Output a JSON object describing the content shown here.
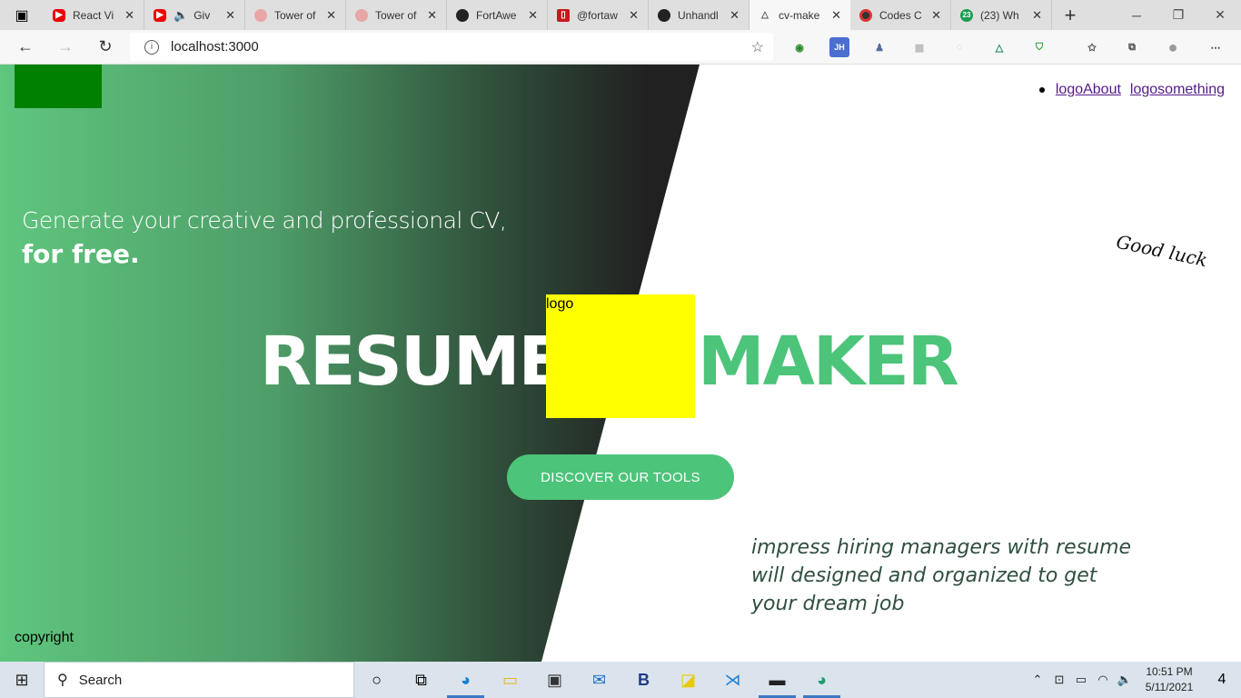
{
  "browser": {
    "tabs": [
      {
        "title": "React Vi",
        "icon": "youtube-icon"
      },
      {
        "title": "Giv",
        "icon": "youtube-icon",
        "audio": true
      },
      {
        "title": "Tower of",
        "icon": "tower-icon"
      },
      {
        "title": "Tower of",
        "icon": "tower-icon"
      },
      {
        "title": "FortAwe",
        "icon": "github-icon"
      },
      {
        "title": "@fortaw",
        "icon": "red-icon"
      },
      {
        "title": "Unhandl",
        "icon": "github-icon"
      },
      {
        "title": "cv-make",
        "icon": "cv-icon",
        "active": true
      },
      {
        "title": "Codes C",
        "icon": "codes-icon"
      },
      {
        "title": "(23) Wh",
        "icon": "whatsapp-icon",
        "badge": "23"
      }
    ],
    "address": "localhost:3000"
  },
  "page": {
    "nav": {
      "link1": "logoAbout",
      "link2": "logosomething"
    },
    "tagline": "Generate your creative and professional CV,",
    "tagline_bold": "for free.",
    "good_luck": "Good luck",
    "title_left": "RESUME",
    "logo_label": "logo",
    "title_right": "MAKER",
    "cta": "DISCOVER OUR TOOLS",
    "impress": "impress hiring managers with resume will designed and organized to get your dream job",
    "copyright": "copyright"
  },
  "taskbar": {
    "search_label": "Search",
    "time": "10:51 PM",
    "date": "5/11/2021",
    "notifications": "4"
  },
  "colors": {
    "accent_green": "#4cc47a",
    "logo_green": "#008000",
    "logo_yellow": "#ffff00"
  }
}
